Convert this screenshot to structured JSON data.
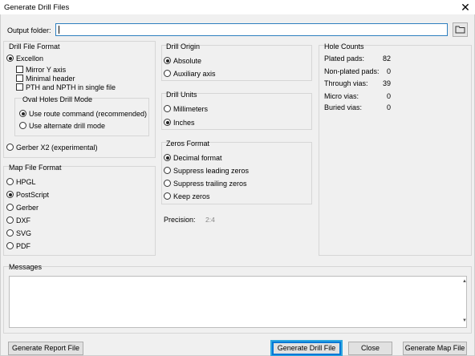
{
  "window": {
    "title": "Generate Drill Files",
    "close_glyph": "✕"
  },
  "output": {
    "label": "Output folder:",
    "value": "",
    "folder_icon": "folder-icon"
  },
  "drill_file_format": {
    "title": "Drill File Format",
    "excellon": "Excellon",
    "excellon_selected": true,
    "mirror_y": "Mirror Y axis",
    "minimal_header": "Minimal header",
    "pth_npth": "PTH and NPTH in single file",
    "oval_title": "Oval Holes Drill Mode",
    "oval_route": "Use route command (recommended)",
    "oval_alt": "Use alternate drill mode",
    "gerber": "Gerber X2 (experimental)"
  },
  "map_file_format": {
    "title": "Map File Format",
    "options": [
      "HPGL",
      "PostScript",
      "Gerber",
      "DXF",
      "SVG",
      "PDF"
    ],
    "selected": "PostScript"
  },
  "drill_origin": {
    "title": "Drill Origin",
    "absolute": "Absolute",
    "auxiliary": "Auxiliary axis"
  },
  "drill_units": {
    "title": "Drill Units",
    "mm": "Millimeters",
    "inches": "Inches"
  },
  "zeros_format": {
    "title": "Zeros Format",
    "options": [
      "Decimal format",
      "Suppress leading zeros",
      "Suppress trailing zeros",
      "Keep zeros"
    ]
  },
  "precision": {
    "label": "Precision:",
    "value": "2:4"
  },
  "hole_counts": {
    "title": "Hole Counts",
    "rows": [
      {
        "label": "Plated pads:",
        "value": "82"
      },
      {
        "label": "Non-plated pads:",
        "value": "0"
      },
      {
        "label": "Through vias:",
        "value": "39"
      },
      {
        "label": "Micro vias:",
        "value": "0"
      },
      {
        "label": "Buried vias:",
        "value": "0"
      }
    ]
  },
  "messages": {
    "label": "Messages",
    "content": ""
  },
  "buttons": {
    "report": "Generate Report File",
    "drill": "Generate Drill File",
    "close": "Close",
    "map": "Generate Map File"
  },
  "colors": {
    "accent": "#0078d7",
    "focus": "#2fa8e0"
  }
}
